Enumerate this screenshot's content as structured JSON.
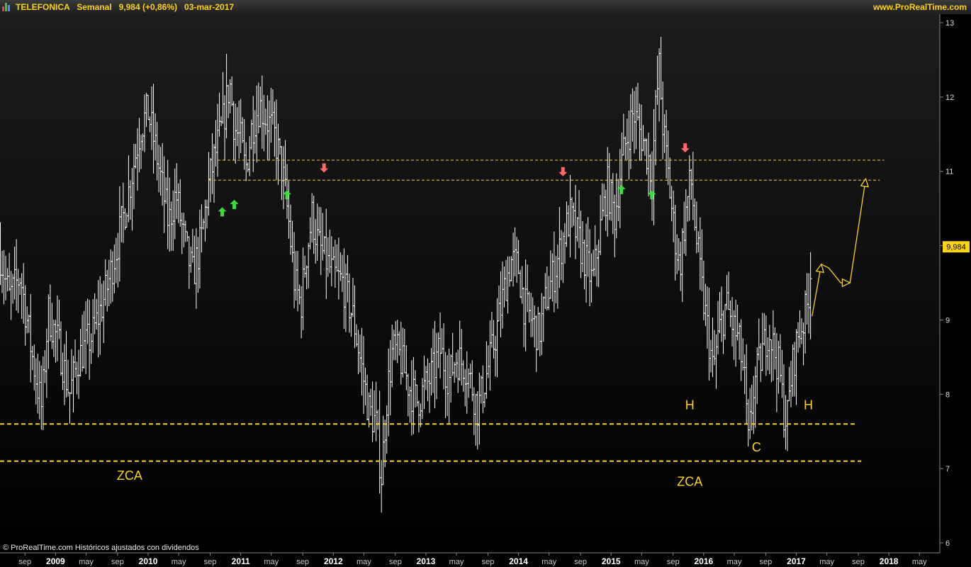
{
  "header": {
    "symbol": "TELEFONICA",
    "period": "Semanal",
    "last_change": "9,984 (+0,86%)",
    "date": "03-mar-2017",
    "site": "www.ProRealTime.com"
  },
  "footer_note": "© ProRealTime.com  Históricos ajustados con dividendos",
  "colors": {
    "accent": "#ffd21a",
    "bars": "#ffffff",
    "up_arrow": "#3ddc3d",
    "down_arrow": "#ff6b6b",
    "background": "#000000"
  },
  "chart_data": {
    "type": "ohlc",
    "frequency": "weekly",
    "ylim": [
      6,
      13
    ],
    "y_ticks": [
      6,
      7,
      8,
      9,
      10,
      11,
      12,
      13
    ],
    "last_price_label": "9,984",
    "last_price": 9.984,
    "x_ticks": [
      {
        "label": "sep",
        "t": 2008.67
      },
      {
        "label": "2009",
        "t": 2009.0
      },
      {
        "label": "may",
        "t": 2009.33
      },
      {
        "label": "sep",
        "t": 2009.67
      },
      {
        "label": "2010",
        "t": 2010.0
      },
      {
        "label": "may",
        "t": 2010.33
      },
      {
        "label": "sep",
        "t": 2010.67
      },
      {
        "label": "2011",
        "t": 2011.0
      },
      {
        "label": "may",
        "t": 2011.33
      },
      {
        "label": "sep",
        "t": 2011.67
      },
      {
        "label": "2012",
        "t": 2012.0
      },
      {
        "label": "may",
        "t": 2012.33
      },
      {
        "label": "sep",
        "t": 2012.67
      },
      {
        "label": "2013",
        "t": 2013.0
      },
      {
        "label": "may",
        "t": 2013.33
      },
      {
        "label": "sep",
        "t": 2013.67
      },
      {
        "label": "2014",
        "t": 2014.0
      },
      {
        "label": "may",
        "t": 2014.33
      },
      {
        "label": "sep",
        "t": 2014.67
      },
      {
        "label": "2015",
        "t": 2015.0
      },
      {
        "label": "may",
        "t": 2015.33
      },
      {
        "label": "sep",
        "t": 2015.67
      },
      {
        "label": "2016",
        "t": 2016.0
      },
      {
        "label": "may",
        "t": 2016.33
      },
      {
        "label": "sep",
        "t": 2016.67
      },
      {
        "label": "2017",
        "t": 2017.0
      },
      {
        "label": "may",
        "t": 2017.33
      },
      {
        "label": "sep",
        "t": 2017.67
      },
      {
        "label": "2018",
        "t": 2018.0
      },
      {
        "label": "may",
        "t": 2018.33
      }
    ],
    "price_path": [
      [
        2008.4,
        9.9
      ],
      [
        2008.5,
        9.3
      ],
      [
        2008.62,
        9.6
      ],
      [
        2008.75,
        8.5
      ],
      [
        2008.85,
        7.8
      ],
      [
        2008.92,
        9.1
      ],
      [
        2009.05,
        8.6
      ],
      [
        2009.15,
        8.0
      ],
      [
        2009.25,
        8.5
      ],
      [
        2009.4,
        8.8
      ],
      [
        2009.55,
        9.4
      ],
      [
        2009.7,
        10.2
      ],
      [
        2009.8,
        10.8
      ],
      [
        2009.92,
        11.6
      ],
      [
        2010.0,
        11.8
      ],
      [
        2010.08,
        11.3
      ],
      [
        2010.15,
        10.8
      ],
      [
        2010.22,
        10.3
      ],
      [
        2010.3,
        10.7
      ],
      [
        2010.4,
        10.0
      ],
      [
        2010.48,
        9.6
      ],
      [
        2010.58,
        10.1
      ],
      [
        2010.65,
        10.8
      ],
      [
        2010.72,
        11.2
      ],
      [
        2010.8,
        11.6
      ],
      [
        2010.88,
        12.2
      ],
      [
        2010.93,
        11.6
      ],
      [
        2011.0,
        11.4
      ],
      [
        2011.05,
        11.0
      ],
      [
        2011.12,
        11.6
      ],
      [
        2011.2,
        11.9
      ],
      [
        2011.28,
        11.7
      ],
      [
        2011.36,
        11.5
      ],
      [
        2011.45,
        11.0
      ],
      [
        2011.52,
        10.3
      ],
      [
        2011.58,
        9.5
      ],
      [
        2011.65,
        9.2
      ],
      [
        2011.7,
        9.8
      ],
      [
        2011.77,
        10.4
      ],
      [
        2011.84,
        10.0
      ],
      [
        2011.92,
        9.8
      ],
      [
        2012.0,
        9.6
      ],
      [
        2012.1,
        9.5
      ],
      [
        2012.22,
        9.0
      ],
      [
        2012.3,
        8.4
      ],
      [
        2012.38,
        7.8
      ],
      [
        2012.46,
        7.6
      ],
      [
        2012.52,
        6.9
      ],
      [
        2012.58,
        8.0
      ],
      [
        2012.64,
        8.6
      ],
      [
        2012.72,
        8.5
      ],
      [
        2012.82,
        8.1
      ],
      [
        2012.9,
        7.9
      ],
      [
        2013.0,
        8.1
      ],
      [
        2013.08,
        8.3
      ],
      [
        2013.15,
        8.6
      ],
      [
        2013.25,
        8.2
      ],
      [
        2013.32,
        8.5
      ],
      [
        2013.42,
        8.4
      ],
      [
        2013.5,
        8.1
      ],
      [
        2013.56,
        7.8
      ],
      [
        2013.64,
        8.2
      ],
      [
        2013.72,
        8.6
      ],
      [
        2013.8,
        9.1
      ],
      [
        2013.86,
        9.5
      ],
      [
        2013.92,
        9.8
      ],
      [
        2014.0,
        9.7
      ],
      [
        2014.06,
        9.2
      ],
      [
        2014.14,
        9.0
      ],
      [
        2014.22,
        8.8
      ],
      [
        2014.3,
        9.3
      ],
      [
        2014.4,
        9.7
      ],
      [
        2014.48,
        10.1
      ],
      [
        2014.56,
        10.4
      ],
      [
        2014.64,
        10.1
      ],
      [
        2014.72,
        9.8
      ],
      [
        2014.8,
        9.5
      ],
      [
        2014.88,
        10.2
      ],
      [
        2014.96,
        10.8
      ],
      [
        2015.04,
        10.4
      ],
      [
        2015.1,
        11.0
      ],
      [
        2015.16,
        11.4
      ],
      [
        2015.24,
        11.8
      ],
      [
        2015.32,
        11.5
      ],
      [
        2015.4,
        11.2
      ],
      [
        2015.44,
        10.9
      ],
      [
        2015.48,
        11.8
      ],
      [
        2015.52,
        12.4
      ],
      [
        2015.56,
        11.6
      ],
      [
        2015.62,
        10.9
      ],
      [
        2015.68,
        10.2
      ],
      [
        2015.74,
        9.7
      ],
      [
        2015.8,
        10.4
      ],
      [
        2015.86,
        10.9
      ],
      [
        2015.92,
        10.1
      ],
      [
        2015.98,
        9.4
      ],
      [
        2016.05,
        8.8
      ],
      [
        2016.1,
        8.3
      ],
      [
        2016.16,
        8.8
      ],
      [
        2016.24,
        9.2
      ],
      [
        2016.32,
        8.9
      ],
      [
        2016.38,
        8.7
      ],
      [
        2016.44,
        8.2
      ],
      [
        2016.48,
        7.3
      ],
      [
        2016.54,
        8.1
      ],
      [
        2016.62,
        8.5
      ],
      [
        2016.7,
        8.9
      ],
      [
        2016.76,
        8.6
      ],
      [
        2016.82,
        8.3
      ],
      [
        2016.86,
        7.8
      ],
      [
        2016.9,
        7.65
      ],
      [
        2016.95,
        8.3
      ],
      [
        2017.02,
        8.8
      ],
      [
        2017.08,
        9.0
      ],
      [
        2017.12,
        9.2
      ],
      [
        2017.15,
        9.6
      ],
      [
        2017.17,
        9.984
      ]
    ],
    "support_lines": [
      {
        "value": 7.6,
        "t_start": 2008.4,
        "t_end": 2017.65
      },
      {
        "value": 7.1,
        "t_start": 2008.4,
        "t_end": 2017.7
      }
    ],
    "resistance_lines": [
      {
        "value": 11.15,
        "t_start": 2010.75,
        "t_end": 2017.95
      },
      {
        "value": 10.88,
        "t_start": 2010.65,
        "t_end": 2017.9
      }
    ],
    "up_arrows": [
      {
        "t": 2010.8,
        "price": 10.45
      },
      {
        "t": 2010.93,
        "price": 10.55
      },
      {
        "t": 2011.5,
        "price": 10.68
      },
      {
        "t": 2015.11,
        "price": 10.75
      },
      {
        "t": 2015.44,
        "price": 10.68
      }
    ],
    "down_arrows": [
      {
        "t": 2011.9,
        "price": 11.05
      },
      {
        "t": 2014.48,
        "price": 11.0
      },
      {
        "t": 2015.8,
        "price": 11.32
      }
    ],
    "projection_path": [
      [
        2017.17,
        9.05
      ],
      [
        2017.27,
        9.75
      ],
      [
        2017.35,
        9.7
      ],
      [
        2017.48,
        9.5
      ],
      [
        2017.58,
        9.5
      ],
      [
        2017.75,
        10.9
      ]
    ],
    "annotations": [
      {
        "text": "ZCA",
        "t": 2009.8,
        "price": 6.85
      },
      {
        "text": "ZCA",
        "t": 2015.85,
        "price": 6.77
      },
      {
        "text": "H",
        "t": 2015.85,
        "price": 7.8
      },
      {
        "text": "H",
        "t": 2017.13,
        "price": 7.8
      },
      {
        "text": "C",
        "t": 2016.57,
        "price": 7.23
      }
    ]
  }
}
